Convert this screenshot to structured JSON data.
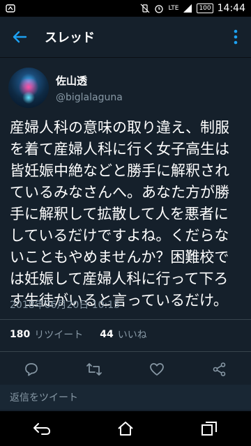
{
  "statusbar": {
    "time": "14:44",
    "battery": "100",
    "network": "LTE"
  },
  "header": {
    "title": "スレッド"
  },
  "profile": {
    "display_name": "佐山透",
    "handle": "@biglalaguna"
  },
  "tweet": {
    "text": "産婦人科の意味の取り違え、制服を着て産婦人科に行く女子高生は皆妊娠中絶などと勝手に解釈されているみなさんへ。あなた方が勝手に解釈して拡散して人を悪者にしているだけですよね。くだらないこともやめませんか？困難校では妊娠して産婦人科に行って下ろす生徒がいると言っているだけ。",
    "timestamp": "2018年06月20日 10:15"
  },
  "stats": {
    "retweets_count": "180",
    "retweets_label": "リツイート",
    "likes_count": "44",
    "likes_label": "いいね"
  },
  "reply": {
    "placeholder": "返信をツイート"
  },
  "colors": {
    "background": "#15202b",
    "accent": "#1da1f2",
    "secondary_text": "#8899a6",
    "divider": "#38444d"
  },
  "icons": {
    "back": "back-arrow-icon",
    "more": "more-vertical-icon",
    "reply": "reply-icon",
    "retweet": "retweet-icon",
    "like": "heart-icon",
    "share": "share-icon",
    "nav_back": "nav-back-icon",
    "nav_home": "nav-home-icon",
    "nav_recent": "nav-recent-apps-icon"
  }
}
